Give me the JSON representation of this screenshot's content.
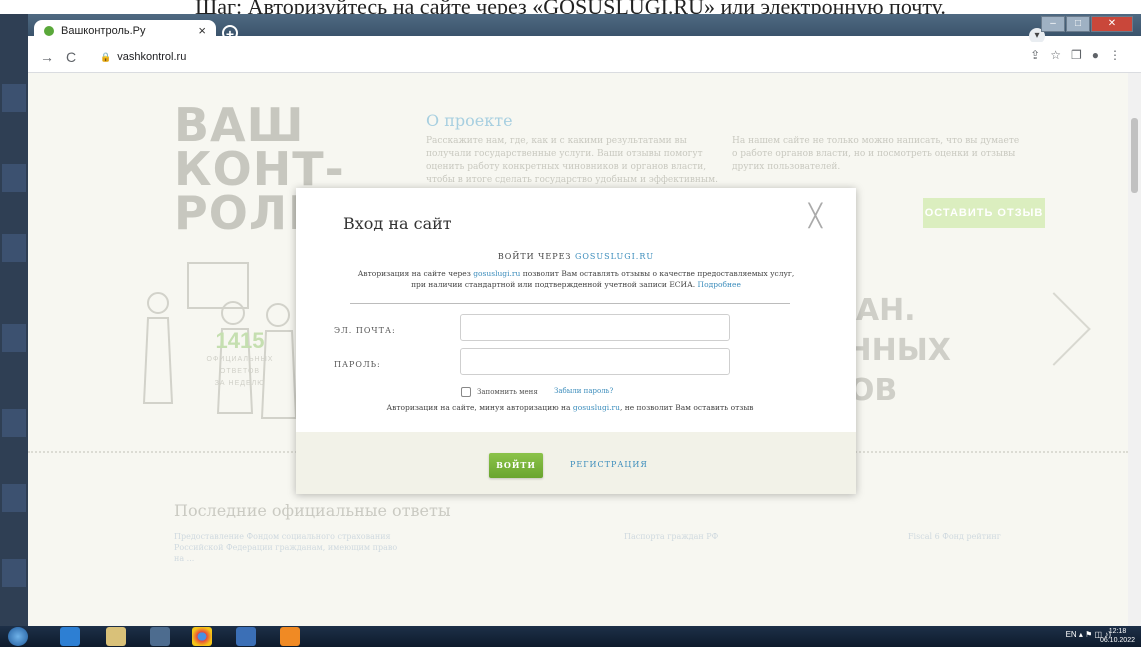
{
  "caption": "Шаг: Авторизуйтесь на сайте через «GOSUSLUGI.RU» или электронную почту.",
  "browser": {
    "tab_title": "Вашконтроль.Ру",
    "tab_close": "×",
    "new_tab": "+",
    "url": "vashkontrol.ru",
    "back": "←",
    "forward": "→",
    "reload": "C"
  },
  "site": {
    "logo_lines": [
      "ВАШ",
      "КОНТ-",
      "РОЛЬ."
    ],
    "about_title": "О проекте",
    "about_text": "Расскажите нам, где, как и с какими результатами вы получали государственные услуги. Ваши отзывы помогут оценить работу конкретных чиновников и органов власти, чтобы в итоге сделать государство удобным и эффективным.",
    "about_text2": "На нашем сайте не только можно написать, что вы думаете о работе органов власти, но и посмотреть оценки и отзывы других пользователей.",
    "cta": "ОСТАВИТЬ ОТЗЫВ",
    "counter_num": "1415",
    "counter_lines": [
      "ОФИЦИАЛЬНЫХ",
      "ОТВЕТОВ",
      "ЗА НЕДЕЛЮ"
    ],
    "big_lines": [
      "МАН.",
      "ЕННЫХ",
      "ВОВ"
    ],
    "recent_title": "Последние официальные ответы",
    "recent_col1": "Предоставление Фондом социального страхования Российской Федерации гражданам, имеющим право на ...",
    "recent_col2": "Паспорта граждан РФ",
    "recent_col3": "Fiscal 6 Фонд рейтинг"
  },
  "modal": {
    "title": "Вход на сайт",
    "close": "╳",
    "via_prefix": "ВОЙТИ ЧЕРЕЗ",
    "via_link": "GOSUSLUGI.RU",
    "auth_note_a": "Авторизация на сайте через",
    "auth_note_link": "gosuslugi.ru",
    "auth_note_b": "позволит Вам оставлять отзывы о качестве предоставляемых услуг, при наличии стандартной или подтвержденной учетной записи ЕСИА.",
    "auth_note_more": "Подробнее",
    "email_label": "ЭЛ. ПОЧТА:",
    "email_value": "",
    "password_label": "ПАРОЛЬ:",
    "password_value": "",
    "remember": "Запомнить меня",
    "forgot": "Забыли пароль?",
    "warn_a": "Авторизация на сайте, минуя авторизацию на",
    "warn_link": "gosuslugi.ru",
    "warn_b": ", не позволит Вам оставить отзыв",
    "login": "ВОЙТИ",
    "register": "РЕГИСТРАЦИЯ"
  },
  "taskbar": {
    "lang": "EN",
    "time": "12:18",
    "date": "06.10.2022"
  },
  "colors": {
    "accent_green": "#7cb342",
    "link_blue": "#3c8dbc"
  }
}
